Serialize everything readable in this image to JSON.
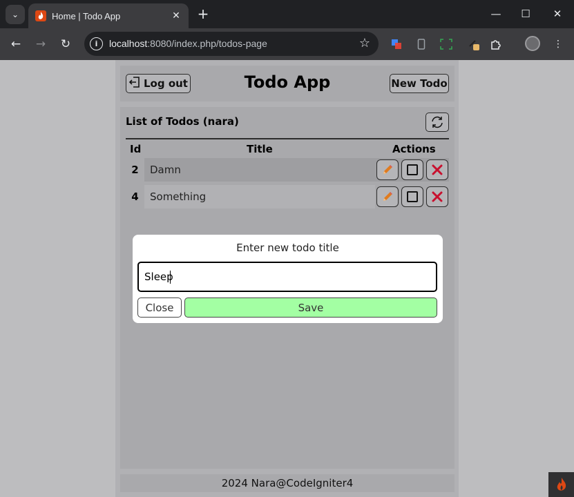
{
  "browser": {
    "tab_title": "Home | Todo App",
    "url_host": "localhost",
    "url_path": ":8080/index.php/todos-page"
  },
  "header": {
    "logout_label": "Log out",
    "title": "Todo App",
    "new_todo_label": "New Todo"
  },
  "list": {
    "heading": "List of Todos (nara)",
    "columns": {
      "id": "Id",
      "title": "Title",
      "actions": "Actions"
    },
    "rows": [
      {
        "id": "2",
        "title": "Damn"
      },
      {
        "id": "4",
        "title": "Something"
      }
    ]
  },
  "modal": {
    "label": "Enter new todo title",
    "input_value": "Sleep",
    "close_label": "Close",
    "save_label": "Save"
  },
  "footer": {
    "text": "2024 Nara@CodeIgniter4"
  },
  "colors": {
    "save_green": "#a3ffa3",
    "delete_red": "#c8102e",
    "pencil_orange": "#e07b1f",
    "codeigniter_orange": "#dd4814"
  }
}
